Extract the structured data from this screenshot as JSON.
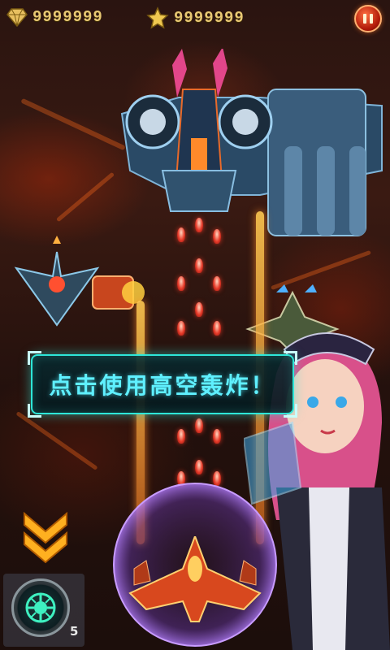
{
  "hud": {
    "gems": "9999999",
    "stars": "9999999",
    "gem_icon": "diamond-gem-icon",
    "star_icon": "gold-star-icon",
    "pause_icon": "pause-icon"
  },
  "tutorial": {
    "message": "点击使用高空轰炸！"
  },
  "bomb": {
    "count": "5",
    "icon": "bomb-special-icon"
  },
  "colors": {
    "banner_border": "#2ee6d8",
    "banner_text": "#5ff0ff",
    "currency_text": "#e8c873",
    "hint_chevrons": "#ffb020"
  }
}
